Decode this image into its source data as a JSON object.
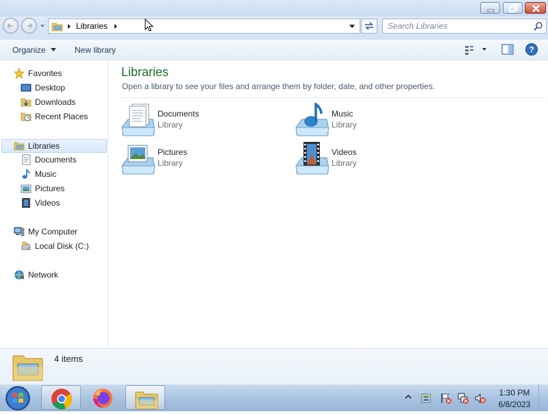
{
  "window": {
    "title": ""
  },
  "address": {
    "crumb": "Libraries"
  },
  "search": {
    "placeholder": "Search Libraries"
  },
  "toolbar": {
    "organize_label": "Organize",
    "new_library_label": "New library"
  },
  "nav": {
    "favorites": {
      "label": "Favorites",
      "items": [
        {
          "label": "Desktop"
        },
        {
          "label": "Downloads"
        },
        {
          "label": "Recent Places"
        }
      ]
    },
    "libraries": {
      "label": "Libraries",
      "items": [
        {
          "label": "Documents"
        },
        {
          "label": "Music"
        },
        {
          "label": "Pictures"
        },
        {
          "label": "Videos"
        }
      ]
    },
    "computer": {
      "label": "My Computer",
      "items": [
        {
          "label": "Local Disk (C:)"
        }
      ]
    },
    "network": {
      "label": "Network"
    }
  },
  "content": {
    "title": "Libraries",
    "description": "Open a library to see your files and arrange them by folder, date, and other properties.",
    "libraries": [
      {
        "name": "Documents",
        "type": "Library",
        "icon": "documents-library-icon"
      },
      {
        "name": "Music",
        "type": "Library",
        "icon": "music-library-icon"
      },
      {
        "name": "Pictures",
        "type": "Library",
        "icon": "pictures-library-icon"
      },
      {
        "name": "Videos",
        "type": "Library",
        "icon": "videos-library-icon"
      }
    ]
  },
  "details": {
    "item_count": "4 items"
  },
  "taskbar": {
    "apps": [
      "chrome-icon",
      "firefox-icon",
      "libraries-explorer-icon"
    ],
    "clock_time": "1:30 PM",
    "clock_date": "6/8/2023"
  },
  "colors": {
    "title_green": "#1e6e25",
    "selection_blue": "#d9e9fb",
    "close_red": "#c7503b"
  }
}
